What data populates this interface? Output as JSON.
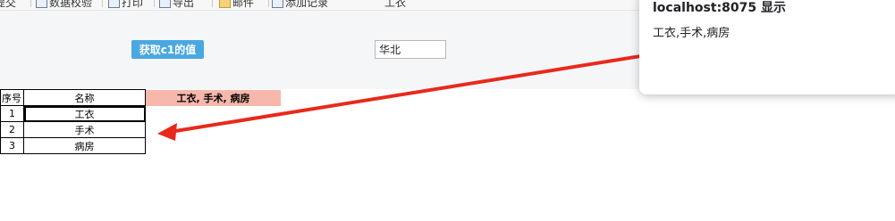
{
  "toolbar": {
    "items": [
      {
        "icon": "submit-icon",
        "label": "提交"
      },
      {
        "icon": "data-check-icon",
        "label": "数据校验"
      },
      {
        "icon": "print-icon",
        "label": "打印"
      },
      {
        "icon": "export-icon",
        "label": "导出"
      },
      {
        "icon": "mail-icon",
        "label": "邮件"
      },
      {
        "icon": "add-record-icon",
        "label": "添加记录"
      }
    ],
    "field_value": "工衣"
  },
  "params": {
    "get_value_button": "获取c1的值",
    "region_value": "华北"
  },
  "table": {
    "headers": [
      "序号",
      "名称"
    ],
    "rows": [
      {
        "index": "1",
        "name": "工衣"
      },
      {
        "index": "2",
        "name": "手术"
      },
      {
        "index": "3",
        "name": "病房"
      }
    ],
    "result_cell": "工衣, 手术, 病房"
  },
  "alert": {
    "title": "localhost:8075 显示",
    "message": "工衣,手术,病房"
  },
  "colors": {
    "button_bg": "#4aa8e0",
    "result_bg": "#f8b7ab",
    "arrow": "#e8291c"
  }
}
